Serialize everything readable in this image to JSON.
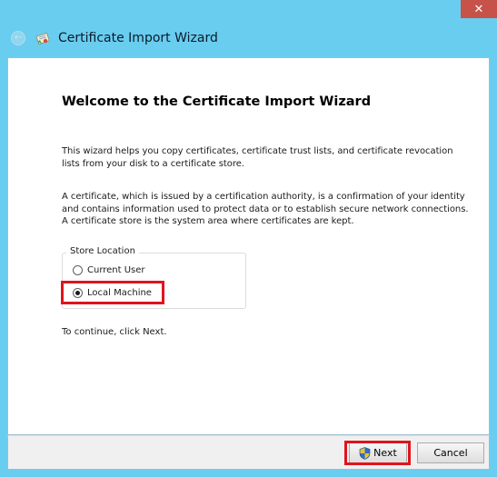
{
  "window": {
    "title": "Certificate Import Wizard",
    "close_label": "✕",
    "back_label": "←",
    "chrome_color": "#69cdf0",
    "highlight_color": "#e0141d"
  },
  "content": {
    "heading": "Welcome to the Certificate Import Wizard",
    "paragraph1": "This wizard helps you copy certificates, certificate trust lists, and certificate revocation lists from your disk to a certificate store.",
    "paragraph2": "A certificate, which is issued by a certification authority, is a confirmation of your identity and contains information used to protect data or to establish secure network connections. A certificate store is the system area where certificates are kept.",
    "store_location": {
      "legend": "Store Location",
      "options": [
        {
          "label": "Current User",
          "selected": false
        },
        {
          "label": "Local Machine",
          "selected": true
        }
      ]
    },
    "continue_text": "To continue, click Next."
  },
  "footer": {
    "next_label": "Next",
    "cancel_label": "Cancel"
  },
  "icons": {
    "title_icon": "certificate-icon",
    "next_icon": "uac-shield-icon",
    "back_icon": "back-arrow-icon",
    "close_icon": "close-icon"
  }
}
